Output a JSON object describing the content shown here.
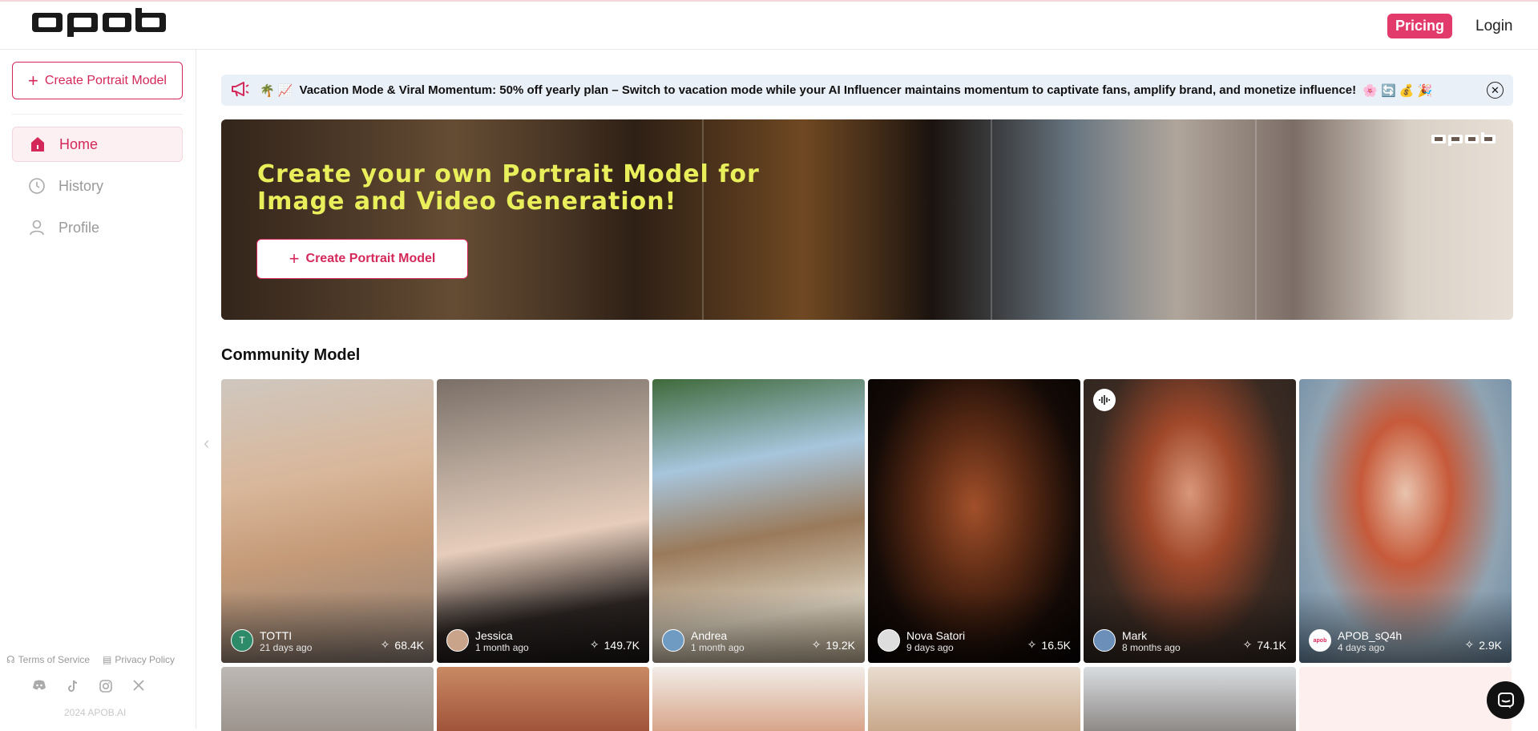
{
  "header": {
    "logo": "apob",
    "pricing": "Pricing",
    "login": "Login"
  },
  "sidebar": {
    "create_button": "Create Portrait Model",
    "items": [
      {
        "label": "Home",
        "icon": "home-icon",
        "active": true
      },
      {
        "label": "History",
        "icon": "clock-icon",
        "active": false
      },
      {
        "label": "Profile",
        "icon": "user-icon",
        "active": false
      }
    ],
    "footer": {
      "terms": "Terms of Service",
      "privacy": "Privacy Policy",
      "socials": [
        "discord-icon",
        "tiktok-icon",
        "instagram-icon",
        "x-icon"
      ],
      "copyright": "2024 APOB.AI"
    }
  },
  "announcement": {
    "emojis_prefix": "🌴 📈",
    "text": "Vacation Mode & Viral Momentum: 50% off yearly plan – Switch to vacation mode while your AI Influencer maintains momentum to captivate fans, amplify brand, and monetize influence!",
    "emojis_suffix": "🌸 🔄 💰 🎉"
  },
  "hero": {
    "title": "Create your own Portrait Model for Image and Video Generation!",
    "button": "Create Portrait Model",
    "watermark": "apob"
  },
  "community": {
    "title": "Community Model",
    "cards": [
      {
        "name": "TOTTI",
        "time": "21 days ago",
        "likes": "68.4K",
        "avatar": "T"
      },
      {
        "name": "Jessica",
        "time": "1 month ago",
        "likes": "149.7K",
        "avatar": ""
      },
      {
        "name": "Andrea",
        "time": "1 month ago",
        "likes": "19.2K",
        "avatar": ""
      },
      {
        "name": "Nova Satori",
        "time": "9 days ago",
        "likes": "16.5K",
        "avatar": ""
      },
      {
        "name": "Mark",
        "time": "8 months ago",
        "likes": "74.1K",
        "avatar": ""
      },
      {
        "name": "APOB_sQ4h",
        "time": "4 days ago",
        "likes": "2.9K",
        "avatar": "apob"
      }
    ]
  },
  "colors": {
    "accent": "#d4285a",
    "pricing_bg": "#e23a6a",
    "announcement_bg": "#e9f0f8",
    "hero_title": "#e9ef5a"
  }
}
